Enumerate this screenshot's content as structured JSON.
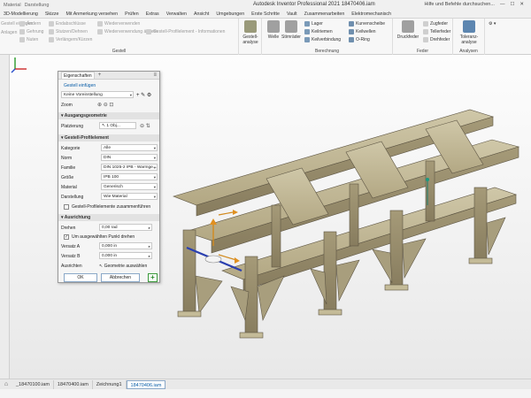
{
  "titlebar": {
    "qat": [
      "Material",
      "Darstellung"
    ],
    "title": "Autodesk Inventor Professional 2021  18470406.iam",
    "help_search": "Hilfe und Befehle durchsuchen...",
    "window_controls": [
      "—",
      "☐",
      "✕"
    ]
  },
  "tabs": [
    "3D-Modellierung",
    "Skizze",
    "Mit Anmerkung versehen",
    "Prüfen",
    "Extras",
    "Verwalten",
    "Ansicht",
    "Umgebungen",
    "Erste Schritte",
    "Vault",
    "Zusammenarbeiten",
    "Elektromechanisch"
  ],
  "ribbon": {
    "left_items": [
      "Ändern",
      "Gehrung",
      "Nuten",
      "Einrasten"
    ],
    "mid_items": [
      "Endabschlüsse",
      "Stutzen/Dehnen",
      "Verlängern/Kürzen"
    ],
    "right_items": [
      "Wiederverwenden",
      "Wiederverwendung ändern",
      "Gestell-Profilelement - Informationen"
    ],
    "left_cut": [
      "Gestell einfügen",
      "Anlagen"
    ],
    "group_gestell": "Gestell",
    "gestell_analyse": "Gestell-\nanalyse",
    "welle": "Welle",
    "stirnrad": "Stirnräder",
    "berechnung_items": [
      "Lager",
      "Keilriemen",
      "Keilverbindung"
    ],
    "kurven_items": [
      "Kurvenscheibe",
      "Keilwellen",
      "O-Ring"
    ],
    "group_berechnung": "Berechnung",
    "druckfeder": "Druckfeder",
    "feder_items": [
      "Zugfeder",
      "Tellerfeder",
      "Drehfeder"
    ],
    "group_feder": "Feder",
    "toleranz": "Toleranz-\nanalyse",
    "group_analysen": "Analysen"
  },
  "panel": {
    "tab": "Eigenschaften",
    "add_link": "Gestell einfügen",
    "preset": "Keine Voreinstellung",
    "zoom_label": "Zoom",
    "sec_ausgangs": "Ausgangsgeometrie",
    "platzierung_label": "Platzierung",
    "platzierung_value": "1 Obj...",
    "sec_profil": "Gestell-Profilelement",
    "kategorie_label": "Kategorie",
    "kategorie_value": "Alle",
    "norm_label": "Norm",
    "norm_value": "DIN",
    "familie_label": "Familie",
    "familie_value": "DIN 1025-2 IPB - Warmge...",
    "groesse_label": "Größe",
    "groesse_value": "IPB 100",
    "material_label": "Material",
    "material_value": "Generisch",
    "darstellung_label": "Darstellung",
    "darstellung_value": "Wie Material",
    "merge_label": "Gestell-Profilelemente zusammenführen",
    "sec_ausrichtung": "Ausrichtung",
    "drehen_label": "Drehen",
    "drehen_value": "0,00 rad",
    "um_punkt_label": "Um ausgewählten Punkt drehen",
    "versatz_a_label": "Versatz A",
    "versatz_a_value": "0,000 in",
    "versatz_b_label": "Versatz B",
    "versatz_b_value": "0,000 in",
    "ausrichten_label": "Ausrichten",
    "ausrichten_value": "Geometrie auswählen",
    "ok": "OK",
    "abbrechen": "Abbrechen",
    "plus": "+"
  },
  "doc_tabs": [
    "_18470100.iam",
    "18470400.iam",
    "Zeichnung1",
    "18470406.iam"
  ],
  "active_doc": 3,
  "colors": {
    "frame": "#b7ac8a",
    "frame_dark": "#8f8468",
    "accent": "#0a5ea8"
  }
}
